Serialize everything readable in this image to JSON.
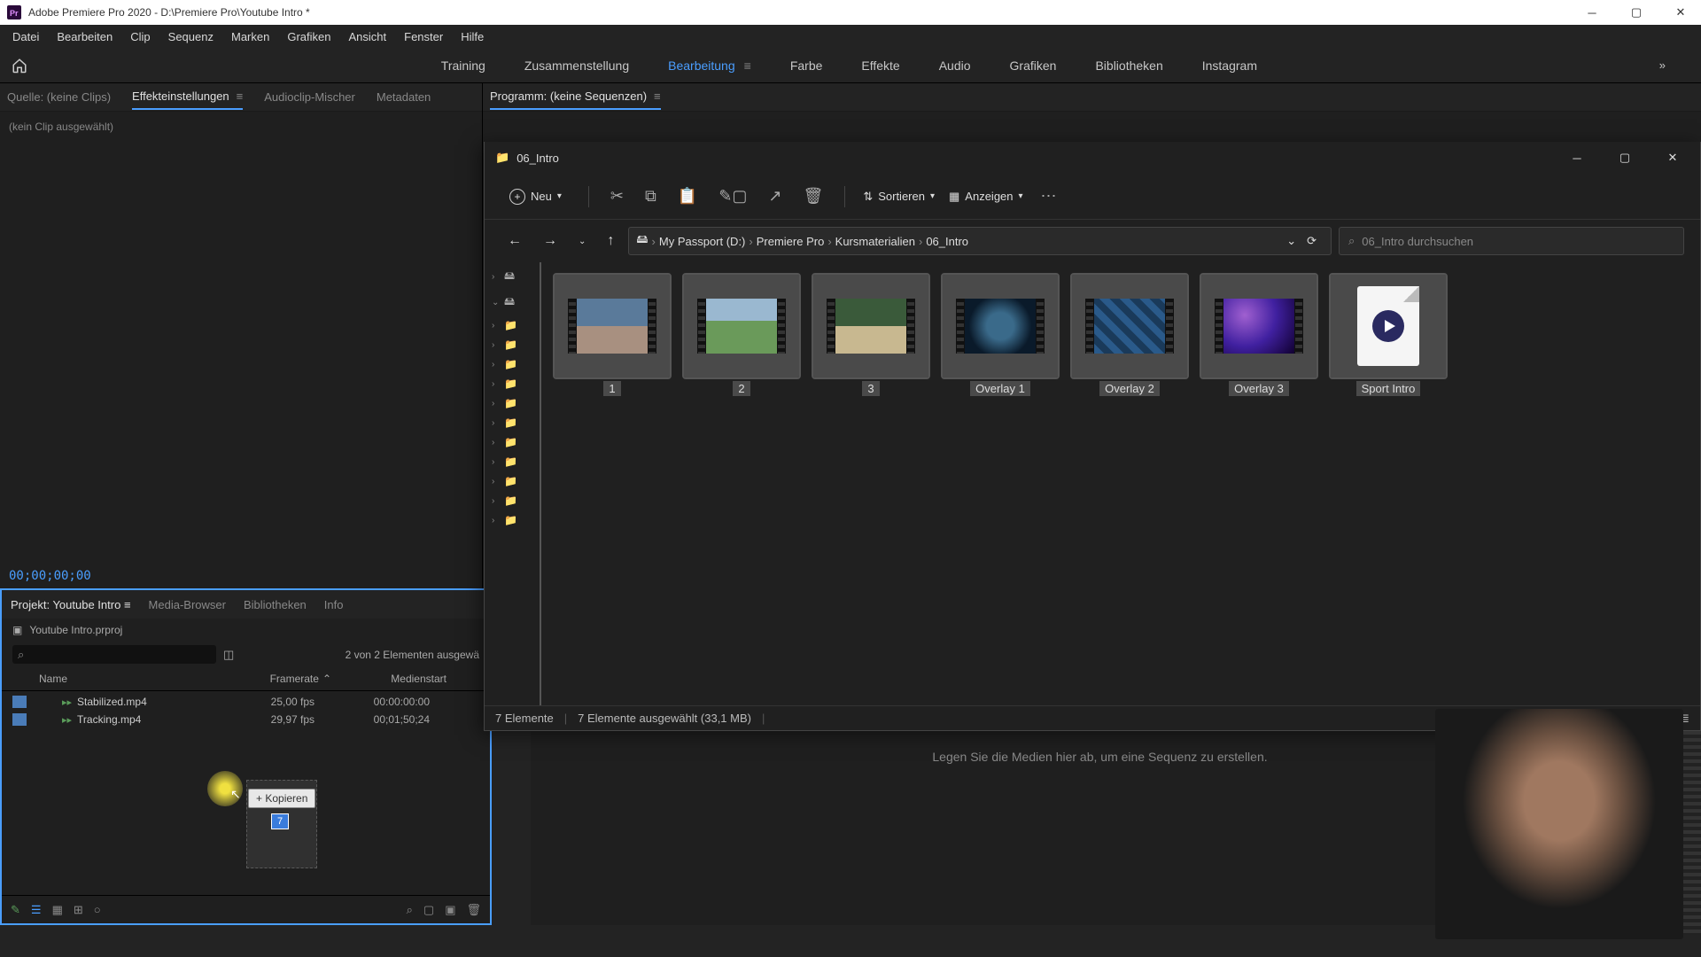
{
  "app": {
    "title": "Adobe Premiere Pro 2020 - D:\\Premiere Pro\\Youtube Intro *"
  },
  "menu": {
    "items": [
      "Datei",
      "Bearbeiten",
      "Clip",
      "Sequenz",
      "Marken",
      "Grafiken",
      "Ansicht",
      "Fenster",
      "Hilfe"
    ]
  },
  "workspaces": {
    "items": [
      "Training",
      "Zusammenstellung",
      "Bearbeitung",
      "Farbe",
      "Effekte",
      "Audio",
      "Grafiken",
      "Bibliotheken",
      "Instagram"
    ],
    "active_index": 2
  },
  "source_tabs": {
    "items": [
      "Quelle: (keine Clips)",
      "Effekteinstellungen",
      "Audioclip-Mischer",
      "Metadaten"
    ],
    "active_index": 1,
    "empty_text": "(kein Clip ausgewählt)",
    "timecode": "00;00;00;00"
  },
  "program_tabs": {
    "items": [
      "Programm: (keine Sequenzen)"
    ]
  },
  "project": {
    "tabs": [
      "Projekt: Youtube Intro",
      "Media-Browser",
      "Bibliotheken",
      "Info"
    ],
    "active_index": 0,
    "filename": "Youtube Intro.prproj",
    "status": "2 von 2 Elementen ausgewä",
    "columns": {
      "name": "Name",
      "framerate": "Framerate",
      "mediastart": "Medienstart"
    },
    "rows": [
      {
        "name": "Stabilized.mp4",
        "fps": "25,00 fps",
        "start": "00:00:00:00"
      },
      {
        "name": "Tracking.mp4",
        "fps": "29,97 fps",
        "start": "00;01;50;24"
      }
    ],
    "drag": {
      "tooltip": "+ Kopieren",
      "count": "7"
    }
  },
  "timeline": {
    "empty_text": "Legen Sie die Medien hier ab, um eine Sequenz zu erstellen."
  },
  "explorer": {
    "title": "06_Intro",
    "toolbar": {
      "new": "Neu",
      "sort": "Sortieren",
      "view": "Anzeigen"
    },
    "breadcrumb": [
      "My Passport (D:)",
      "Premiere Pro",
      "Kursmaterialien",
      "06_Intro"
    ],
    "search_placeholder": "06_Intro durchsuchen",
    "files": [
      {
        "label": "1",
        "kind": "video",
        "thumb": "thumb-1"
      },
      {
        "label": "2",
        "kind": "video",
        "thumb": "thumb-2"
      },
      {
        "label": "3",
        "kind": "video",
        "thumb": "thumb-3"
      },
      {
        "label": "Overlay 1",
        "kind": "video",
        "thumb": "thumb-o1"
      },
      {
        "label": "Overlay 2",
        "kind": "video",
        "thumb": "thumb-o2"
      },
      {
        "label": "Overlay 3",
        "kind": "video",
        "thumb": "thumb-o3"
      },
      {
        "label": "Sport Intro",
        "kind": "project",
        "thumb": ""
      }
    ],
    "status": {
      "count": "7 Elemente",
      "selected": "7 Elemente ausgewählt (33,1 MB)"
    }
  }
}
